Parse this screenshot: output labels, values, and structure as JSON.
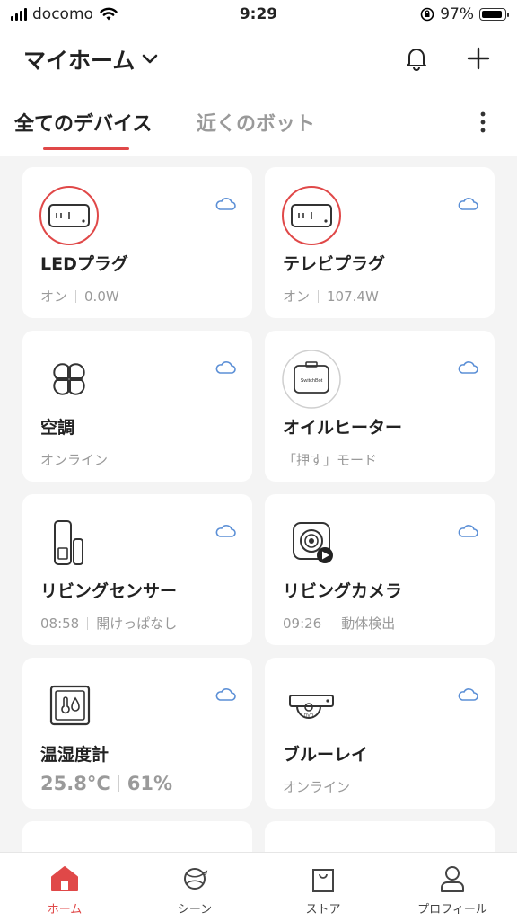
{
  "status_bar": {
    "carrier": "docomo",
    "time": "9:29",
    "battery": "97%",
    "battery_level": 0.97
  },
  "header": {
    "home_name": "マイホーム"
  },
  "tabs": [
    {
      "label": "全てのデバイス",
      "active": true
    },
    {
      "label": "近くのボット",
      "active": false
    }
  ],
  "devices": [
    {
      "name": "LEDプラグ",
      "status": [
        "オン",
        "0.0W"
      ],
      "icon": "plug-icon"
    },
    {
      "name": "テレビプラグ",
      "status": [
        "オン",
        "107.4W"
      ],
      "icon": "plug-icon"
    },
    {
      "name": "空調",
      "status": [
        "オンライン"
      ],
      "icon": "fan-icon"
    },
    {
      "name": "オイルヒーター",
      "status": [
        "「押す」モード"
      ],
      "icon": "switchbot-icon",
      "brand_text": "SwitchBot"
    },
    {
      "name": "リビングセンサー",
      "status": [
        "08:58",
        "開けっぱなし"
      ],
      "icon": "contact-sensor-icon"
    },
    {
      "name": "リビングカメラ",
      "status": [
        "09:26",
        "動体検出"
      ],
      "icon": "camera-icon"
    },
    {
      "name": "温湿度計",
      "status": [
        "25.8°C",
        "61%"
      ],
      "icon": "thermo-hygrometer-icon"
    },
    {
      "name": "ブルーレイ",
      "status": [
        "オンライン"
      ],
      "icon": "bluray-player-icon",
      "brand_text": "DVD"
    }
  ],
  "nav": [
    {
      "label": "ホーム",
      "icon": "home-icon",
      "active": true
    },
    {
      "label": "シーン",
      "icon": "scene-icon",
      "active": false
    },
    {
      "label": "ストア",
      "icon": "store-bag-icon",
      "active": false
    },
    {
      "label": "プロフィール",
      "icon": "profile-icon",
      "active": false
    }
  ],
  "colors": {
    "accent": "#e04848",
    "cloud": "#5b8fd6",
    "background": "#f4f4f4"
  }
}
